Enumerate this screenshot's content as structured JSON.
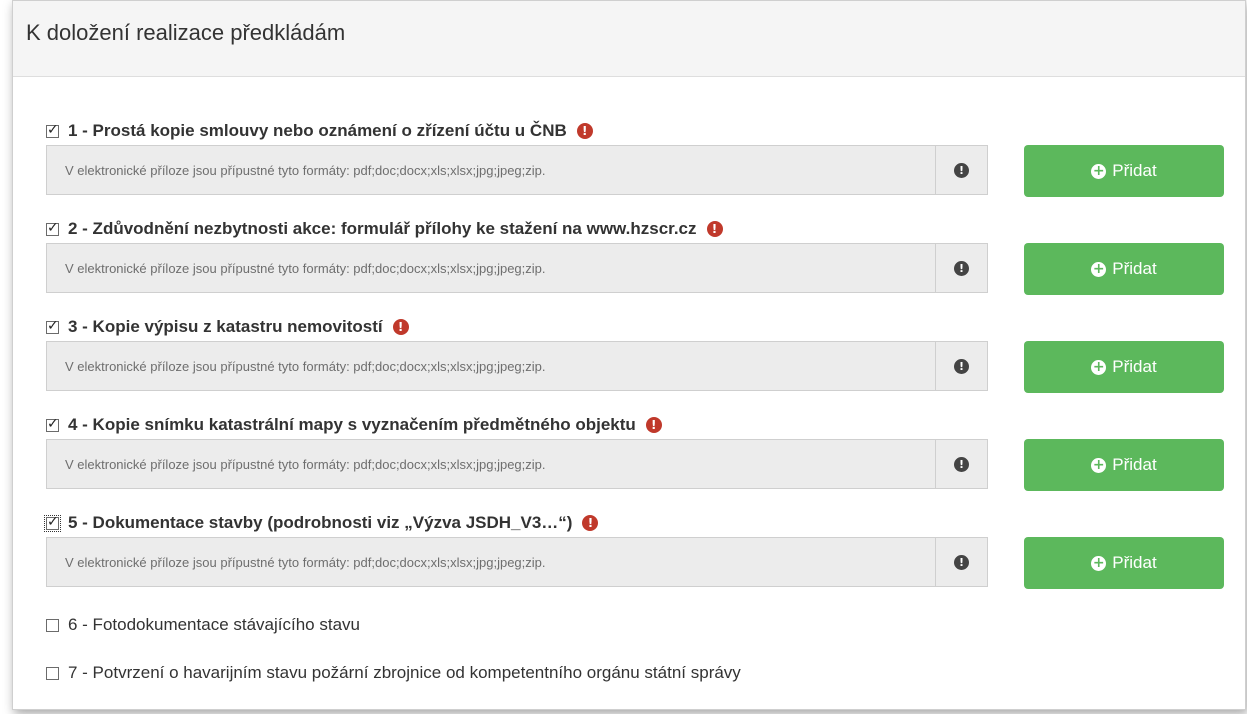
{
  "panel": {
    "title": "K doložení realizace předkládám"
  },
  "attachments": [
    {
      "label": "1 - Prostá kopie smlouvy nebo oznámení o zřízení účtu u ČNB",
      "checked": true,
      "required": true,
      "file_info": "V elektronické příloze jsou přípustné tyto formáty: pdf;doc;docx;xls;xlsx;jpg;jpeg;zip.",
      "add_label": "Přidat"
    },
    {
      "label": "2 - Zdůvodnění nezbytnosti akce: formulář přílohy ke stažení na www.hzscr.cz",
      "checked": true,
      "required": true,
      "file_info": "V elektronické příloze jsou přípustné tyto formáty: pdf;doc;docx;xls;xlsx;jpg;jpeg;zip.",
      "add_label": "Přidat"
    },
    {
      "label": "3 - Kopie výpisu z katastru nemovitostí",
      "checked": true,
      "required": true,
      "file_info": "V elektronické příloze jsou přípustné tyto formáty: pdf;doc;docx;xls;xlsx;jpg;jpeg;zip.",
      "add_label": "Přidat"
    },
    {
      "label": "4 - Kopie snímku katastrální mapy s vyznačením předmětného objektu",
      "checked": true,
      "required": true,
      "file_info": "V elektronické příloze jsou přípustné tyto formáty: pdf;doc;docx;xls;xlsx;jpg;jpeg;zip.",
      "add_label": "Přidat"
    },
    {
      "label": "5 - Dokumentace stavby (podrobnosti viz „Výzva JSDH_V3…“)",
      "checked": true,
      "required": true,
      "file_info": "V elektronické příloze jsou přípustné tyto formáty: pdf;doc;docx;xls;xlsx;jpg;jpeg;zip.",
      "add_label": "Přidat"
    },
    {
      "label": "6 - Fotodokumentace stávajícího stavu",
      "checked": false,
      "required": false
    },
    {
      "label": "7 - Potvrzení o havarijním stavu požární zbrojnice od kompetentního orgánu státní správy",
      "checked": false,
      "required": false
    }
  ],
  "icons": {
    "warning": "exclamation-circle-icon",
    "add": "plus-circle-icon"
  },
  "colors": {
    "add_button": "#5cb85c",
    "warning": "#c0392b",
    "panel_header_bg": "#f5f5f5"
  }
}
